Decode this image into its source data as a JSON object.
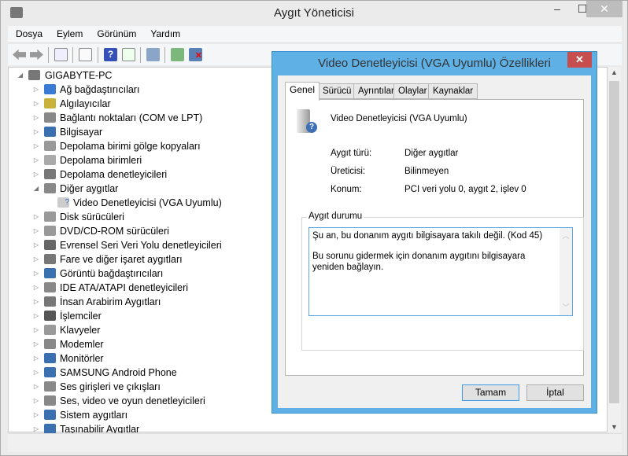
{
  "window": {
    "title": "Aygıt Yöneticisi",
    "minimize": "–",
    "maximize": "☐",
    "close": "✕"
  },
  "menu": [
    "Dosya",
    "Eylem",
    "Görünüm",
    "Yardım"
  ],
  "tree": {
    "root": "GIGABYTE-PC",
    "items": [
      {
        "label": "Ağ bağdaştırıcıları",
        "color": "#3a7bd5"
      },
      {
        "label": "Algılayıcılar",
        "color": "#c9b23a"
      },
      {
        "label": "Bağlantı noktaları (COM ve LPT)",
        "color": "#888"
      },
      {
        "label": "Bilgisayar",
        "color": "#3a6fb0"
      },
      {
        "label": "Depolama birimi gölge kopyaları",
        "color": "#999"
      },
      {
        "label": "Depolama birimleri",
        "color": "#aaa"
      },
      {
        "label": "Depolama denetleyicileri",
        "color": "#777"
      },
      {
        "label": "Diğer aygıtlar",
        "color": "#888",
        "expanded": true,
        "children": [
          "Video Denetleyicisi (VGA Uyumlu)"
        ]
      },
      {
        "label": "Disk sürücüleri",
        "color": "#999"
      },
      {
        "label": "DVD/CD-ROM sürücüleri",
        "color": "#999"
      },
      {
        "label": "Evrensel Seri Veri Yolu denetleyicileri",
        "color": "#666"
      },
      {
        "label": "Fare ve diğer işaret aygıtları",
        "color": "#777"
      },
      {
        "label": "Görüntü bağdaştırıcıları",
        "color": "#3a6fb0"
      },
      {
        "label": "IDE ATA/ATAPI denetleyicileri",
        "color": "#888"
      },
      {
        "label": "İnsan Arabirim Aygıtları",
        "color": "#777"
      },
      {
        "label": "İşlemciler",
        "color": "#555"
      },
      {
        "label": "Klavyeler",
        "color": "#999"
      },
      {
        "label": "Modemler",
        "color": "#888"
      },
      {
        "label": "Monitörler",
        "color": "#3a6fb0"
      },
      {
        "label": "SAMSUNG Android Phone",
        "color": "#3a6fb0"
      },
      {
        "label": "Ses girişleri ve çıkışları",
        "color": "#888"
      },
      {
        "label": "Ses, video ve oyun denetleyicileri",
        "color": "#888"
      },
      {
        "label": "Sistem aygıtları",
        "color": "#3a6fb0"
      },
      {
        "label": "Taşınabilir Aygıtlar",
        "color": "#3a6fb0"
      }
    ]
  },
  "dialog": {
    "title": "Video Denetleyicisi (VGA Uyumlu) Özellikleri",
    "close": "✕",
    "tabs": [
      "Genel",
      "Sürücü",
      "Ayrıntılar",
      "Olaylar",
      "Kaynaklar"
    ],
    "device_name": "Video Denetleyicisi (VGA Uyumlu)",
    "props": [
      {
        "label": "Aygıt türü:",
        "value": "Diğer aygıtlar"
      },
      {
        "label": "Üreticisi:",
        "value": "Bilinmeyen"
      },
      {
        "label": "Konum:",
        "value": "PCI veri yolu 0, aygıt 2, işlev 0"
      }
    ],
    "status_group": "Aygıt durumu",
    "status_line1": "Şu an, bu donanım aygıtı bilgisayara takılı değil. (Kod 45)",
    "status_line2": "Bu sorunu gidermek için donanım aygıtını bilgisayara yeniden bağlayın.",
    "ok": "Tamam",
    "cancel": "İptal"
  }
}
